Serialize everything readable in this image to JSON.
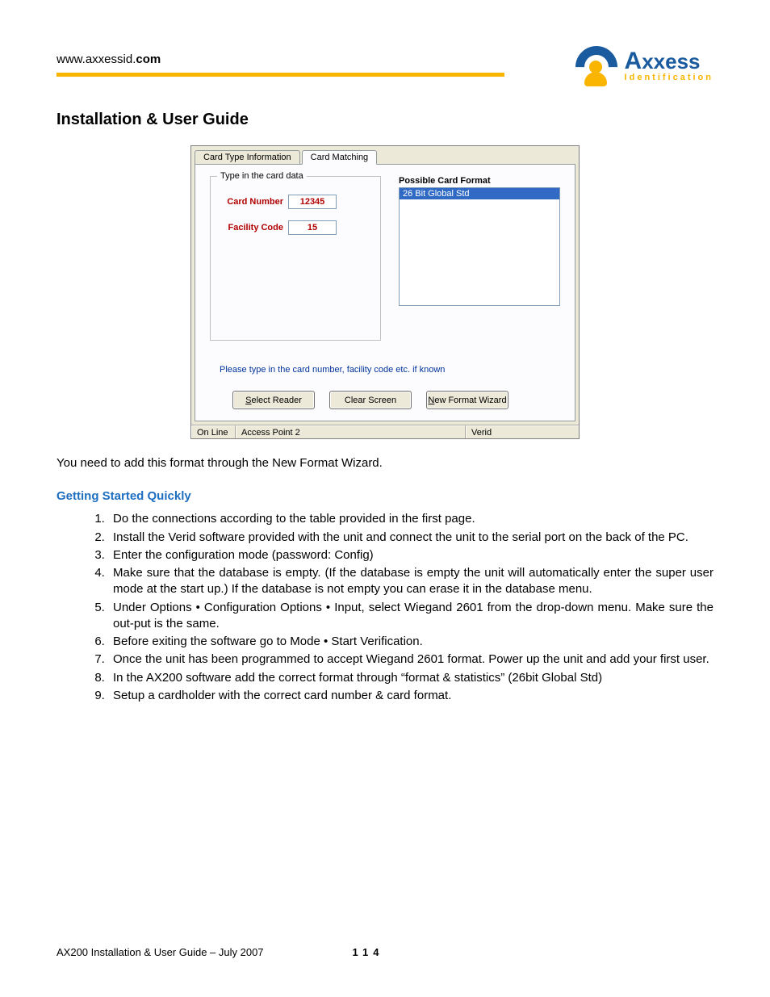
{
  "header": {
    "site_prefix": "www.axxessid.",
    "site_bold": "com",
    "logo_main": "Axxess",
    "logo_sub": "Identification"
  },
  "title": "Installation & User Guide",
  "dialog": {
    "tabs": {
      "t1": "Card Type Information",
      "t2": "Card Matching"
    },
    "fieldset_legend": "Type in the card data",
    "card_number_label": "Card Number",
    "card_number_value": "12345",
    "facility_code_label": "Facility Code",
    "facility_code_value": "15",
    "possible_label": "Possible Card Format",
    "possible_item": "26 Bit Global Std",
    "hint": "Please type in the card number, facility code etc. if known",
    "btn_select_reader_u": "S",
    "btn_select_reader_rest": "elect Reader",
    "btn_clear": "Clear Screen",
    "btn_new_u": "N",
    "btn_new_rest": "ew Format Wizard",
    "status_online": "On Line",
    "status_ap": "Access Point 2",
    "status_verid": "Verid"
  },
  "para1": "You need to add this format through the New Format Wizard.",
  "subheading": "Getting Started Quickly",
  "steps": {
    "s1": "Do the connections according to the table provided in the first page.",
    "s2": "Install the Verid software provided with the unit and connect the unit to the serial port on the back of the PC.",
    "s3": "Enter the configuration mode (password: Config)",
    "s4": "Make sure that the database is empty. (If the database is empty the unit will automatically enter the super user mode at the start up.) If the database is not empty you can erase it in the database menu.",
    "s5": "Under Options • Configuration Options • Input, select Wiegand 2601 from the drop-down menu. Make sure the out-put is the same.",
    "s6": "Before exiting the software go to Mode • Start Verification.",
    "s7": "Once the unit has been programmed to accept Wiegand 2601 format. Power up the unit and add your first user.",
    "s8": "In the AX200 software add the correct format through “format & statistics” (26bit Global Std)",
    "s9": "Setup a cardholder with the correct card number & card format."
  },
  "footer": {
    "left": "AX200 Installation & User Guide – July 2007",
    "page": "114"
  }
}
